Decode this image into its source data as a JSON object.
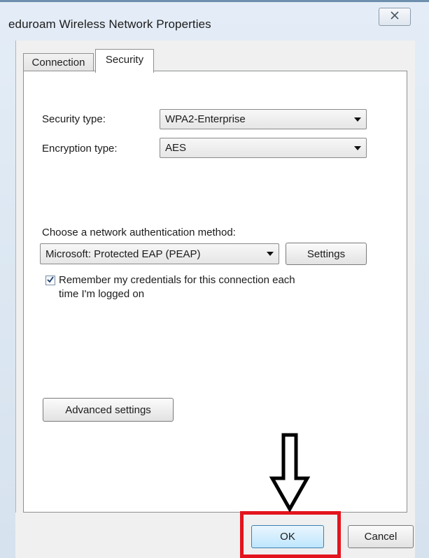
{
  "window": {
    "title": "eduroam Wireless Network Properties",
    "close_icon": "close-icon"
  },
  "tabs": [
    {
      "label": "Connection",
      "active": false
    },
    {
      "label": "Security",
      "active": true
    }
  ],
  "security": {
    "security_type_label": "Security type:",
    "security_type_value": "WPA2-Enterprise",
    "encryption_type_label": "Encryption type:",
    "encryption_type_value": "AES",
    "auth_method_label": "Choose a network authentication method:",
    "auth_method_value": "Microsoft: Protected EAP (PEAP)",
    "settings_button": "Settings",
    "remember_checked": true,
    "remember_line1": "Remember my credentials for this connection each",
    "remember_line2": "time I'm logged on",
    "advanced_button": "Advanced settings"
  },
  "footer": {
    "ok_button": "OK",
    "cancel_button": "Cancel"
  },
  "annotation": {
    "arrow_icon": "down-arrow-icon",
    "highlight_color": "#e3141d"
  }
}
